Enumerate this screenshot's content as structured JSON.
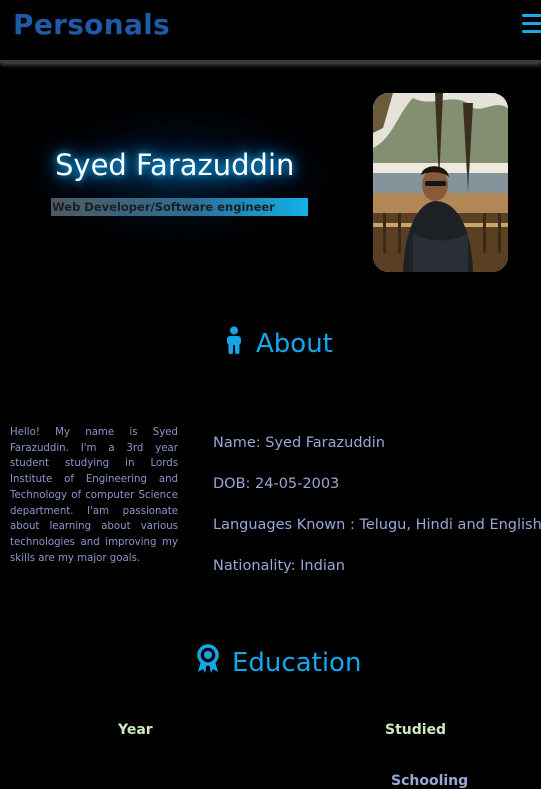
{
  "header": {
    "brand": "Personals",
    "menu_icon": "hamburger-menu-icon",
    "accent_color": "#1aa8e8",
    "brand_color": "#1e5aa6"
  },
  "hero": {
    "name": "Syed Farazuddin",
    "role": "Web Developer/Software engineer",
    "photo": "profile-photo"
  },
  "about": {
    "title": "About",
    "icon": "person-icon",
    "bio": "Hello! My name is Syed Farazuddin. I'm a 3rd year student studying in Lords Institute of Engineering and Technology of computer Science department. I'am passionate about learning about various technologies and improving my skills are my major goals.",
    "details": [
      "Name: Syed Farazuddin",
      "DOB: 24-05-2003",
      "Languages Known : Telugu, Hindi and English",
      "Nationality: Indian"
    ]
  },
  "education": {
    "title": "Education",
    "icon": "award-ribbon-icon",
    "columns": [
      "Year",
      "Studied"
    ],
    "rows": [
      {
        "year": "",
        "studied": "Schooling"
      }
    ]
  }
}
